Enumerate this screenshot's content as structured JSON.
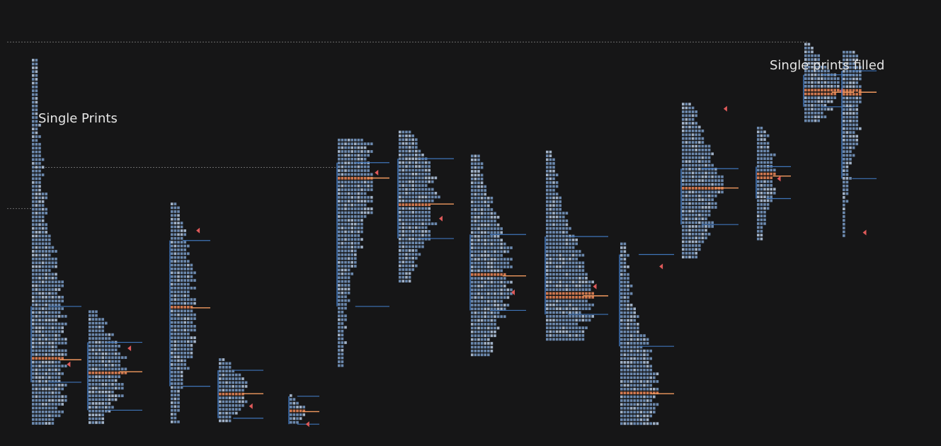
{
  "annotations": {
    "single_prints": "Single Prints",
    "single_prints_filled": "Single prints filled"
  },
  "chart_data": {
    "type": "market-profile",
    "title": "",
    "xlabel": "",
    "ylabel": "",
    "ylim": [
      0,
      100
    ],
    "colors": {
      "background": "#161617",
      "letters": "#7a9cc8",
      "letters_bright": "#b9cce6",
      "poc_letters": "#f08a5a",
      "value_area_line": "#3f74b8",
      "poc_line": "#f29a5f",
      "marker": "#e05a5a",
      "single_print_guide": "#6b6b6b"
    },
    "profiles": [
      {
        "id": "p1",
        "hi": 92.0,
        "lo": 0.0,
        "width": 52,
        "poc": 17.0,
        "va_hi": 30.0,
        "va_lo": 11.0,
        "marker": 15.5
      },
      {
        "id": "p2",
        "hi": 29.0,
        "lo": 0.0,
        "width": 58,
        "poc": 14.0,
        "va_hi": 21.0,
        "va_lo": 4.0,
        "marker": 19.5
      },
      {
        "id": "p3",
        "hi": 56.0,
        "lo": 0.0,
        "width": 38,
        "poc": 30.0,
        "va_hi": 46.5,
        "va_lo": 10.0,
        "marker": 49.0
      },
      {
        "id": "p4",
        "hi": 17.0,
        "lo": 0.0,
        "width": 45,
        "poc": 8.5,
        "va_hi": 14.0,
        "va_lo": 2.0,
        "marker": 5.0
      },
      {
        "id": "p5",
        "hi": 8.0,
        "lo": 0.0,
        "width": 24,
        "poc": 4.0,
        "va_hi": 7.5,
        "va_lo": 0.5,
        "marker": 0.5
      },
      {
        "id": "p6",
        "hi": 72.0,
        "lo": 14.0,
        "width": 55,
        "poc": 62.5,
        "va_hi": 66.0,
        "va_lo": 30.0,
        "marker": 63.5
      },
      {
        "id": "p7",
        "hi": 74.0,
        "lo": 35.0,
        "width": 60,
        "poc": 56.0,
        "va_hi": 67.0,
        "va_lo": 47.0,
        "marker": 52.0
      },
      {
        "id": "p8",
        "hi": 68.0,
        "lo": 17.0,
        "width": 60,
        "poc": 38.0,
        "va_hi": 48.0,
        "va_lo": 29.0,
        "marker": 33.5
      },
      {
        "id": "p9",
        "hi": 69.0,
        "lo": 21.0,
        "width": 70,
        "poc": 33.0,
        "va_hi": 47.5,
        "va_lo": 28.0,
        "marker": 35.0
      },
      {
        "id": "p10",
        "hi": 46.0,
        "lo": 0.0,
        "width": 58,
        "poc": 8.5,
        "va_hi": 43.0,
        "va_lo": 20.0,
        "marker": 40.0
      },
      {
        "id": "p11",
        "hi": 81.0,
        "lo": 41.0,
        "width": 62,
        "poc": 60.0,
        "va_hi": 64.5,
        "va_lo": 50.5,
        "marker": 79.5
      },
      {
        "id": "p12",
        "hi": 75.0,
        "lo": 46.0,
        "width": 30,
        "poc": 63.0,
        "va_hi": 65.0,
        "va_lo": 57.0,
        "marker": 62.0
      },
      {
        "id": "p13",
        "hi": 96.0,
        "lo": 75.0,
        "width": 52,
        "poc": 84.0,
        "va_hi": 88.0,
        "va_lo": 80.0,
        "marker": 84.0
      },
      {
        "id": "p14",
        "hi": 94.0,
        "lo": 47.0,
        "width": 30,
        "poc": 84.0,
        "va_hi": 89.0,
        "va_lo": 62.0,
        "marker": 48.5
      }
    ],
    "single_print_levels": [
      96.2,
      64.8,
      54.5
    ]
  }
}
